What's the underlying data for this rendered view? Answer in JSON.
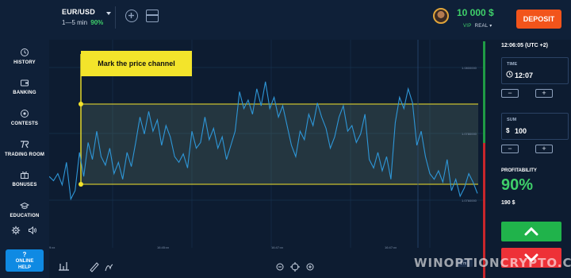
{
  "header": {
    "asset": "EUR/USD",
    "timeframe": "1—5 min",
    "payout_pct": "90%",
    "balance": "10 000 $",
    "vip": "VIP",
    "account": "REAL ▾",
    "deposit_label": "DEPOSIT"
  },
  "sidebar": {
    "items": [
      {
        "label": "HISTORY",
        "icon": "history-icon"
      },
      {
        "label": "BANKING",
        "icon": "wallet-icon"
      },
      {
        "label": "CONTESTS",
        "icon": "contest-icon"
      },
      {
        "label": "TRADING ROOM",
        "icon": "trading-room-icon"
      },
      {
        "label": "BONUSES",
        "icon": "gift-icon"
      },
      {
        "label": "EDUCATION",
        "icon": "graduation-cap-icon"
      }
    ],
    "help_line1": "?",
    "help_line2": "ONLINE",
    "help_line3": "HELP"
  },
  "chart": {
    "hint": "Mark the price channel",
    "price_labels": [
      "1.0800000",
      "1.0780000",
      "1.0760000"
    ],
    "time_labels": [
      "9:xx",
      "16:45:xx",
      "16:47:xx",
      "16:47:xx"
    ],
    "zoom_label": "1 m",
    "price_series": [
      0.72,
      0.75,
      0.7,
      0.78,
      0.62,
      0.88,
      0.82,
      0.55,
      0.72,
      0.48,
      0.6,
      0.4,
      0.58,
      0.64,
      0.52,
      0.7,
      0.62,
      0.74,
      0.55,
      0.65,
      0.48,
      0.3,
      0.42,
      0.26,
      0.4,
      0.32,
      0.5,
      0.36,
      0.44,
      0.58,
      0.62,
      0.56,
      0.66,
      0.4,
      0.52,
      0.48,
      0.3,
      0.46,
      0.38,
      0.52,
      0.44,
      0.6,
      0.5,
      0.4,
      0.12,
      0.24,
      0.18,
      0.28,
      0.1,
      0.22,
      0.05,
      0.24,
      0.16,
      0.3,
      0.22,
      0.36,
      0.5,
      0.58,
      0.4,
      0.46,
      0.28,
      0.36,
      0.2,
      0.3,
      0.38,
      0.52,
      0.44,
      0.3,
      0.22,
      0.4,
      0.36,
      0.48,
      0.42,
      0.28,
      0.6,
      0.66,
      0.55,
      0.68,
      0.58,
      0.74,
      0.34,
      0.16,
      0.24,
      0.1,
      0.2,
      0.5,
      0.4,
      0.58,
      0.7,
      0.74,
      0.68,
      0.76,
      0.6,
      0.82,
      0.74,
      0.86,
      0.8,
      0.7,
      0.76,
      0.84
    ]
  },
  "panel": {
    "clock": "12:06:05 (UTC +2)",
    "time_caption": "TIME",
    "time_value": "12:07",
    "sum_caption": "SUM",
    "currency": "$",
    "sum_value": "100",
    "profit_caption": "PROFITABILITY",
    "profit_pct": "90%",
    "payout": "190 $"
  },
  "watermark": "WINOPTIONCRYPTO.COM",
  "colors": {
    "background": "#0d1c31",
    "accent_green": "#3fd06a",
    "deposit_orange": "#f2541b",
    "channel_yellow": "#f3e42b",
    "price_line": "#2e97d8",
    "up_button": "#20b34b",
    "down_button": "#ee3137"
  }
}
